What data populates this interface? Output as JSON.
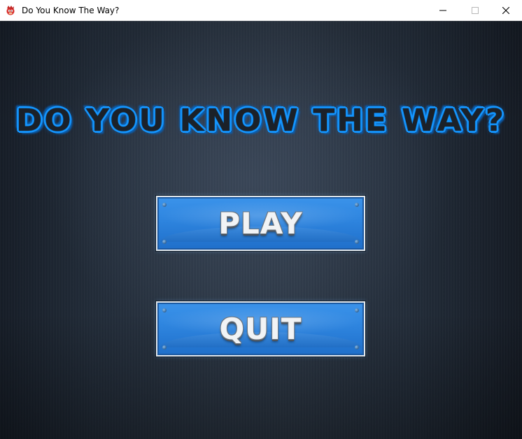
{
  "window": {
    "title": "Do You Know The Way?",
    "icon": "knuckles-icon",
    "controls": {
      "minimize": "minimize-icon",
      "maximize": "maximize-icon",
      "close": "close-icon"
    }
  },
  "game": {
    "title": "DO YOU KNOW THE WAY?",
    "buttons": {
      "play": "PLAY",
      "quit": "QUIT"
    }
  },
  "colors": {
    "title_outline": "#1596ff",
    "title_fill": "#1b2129",
    "button_blue": "#2f86e0",
    "button_text": "#f1f3f5",
    "background": "#2a3543"
  }
}
